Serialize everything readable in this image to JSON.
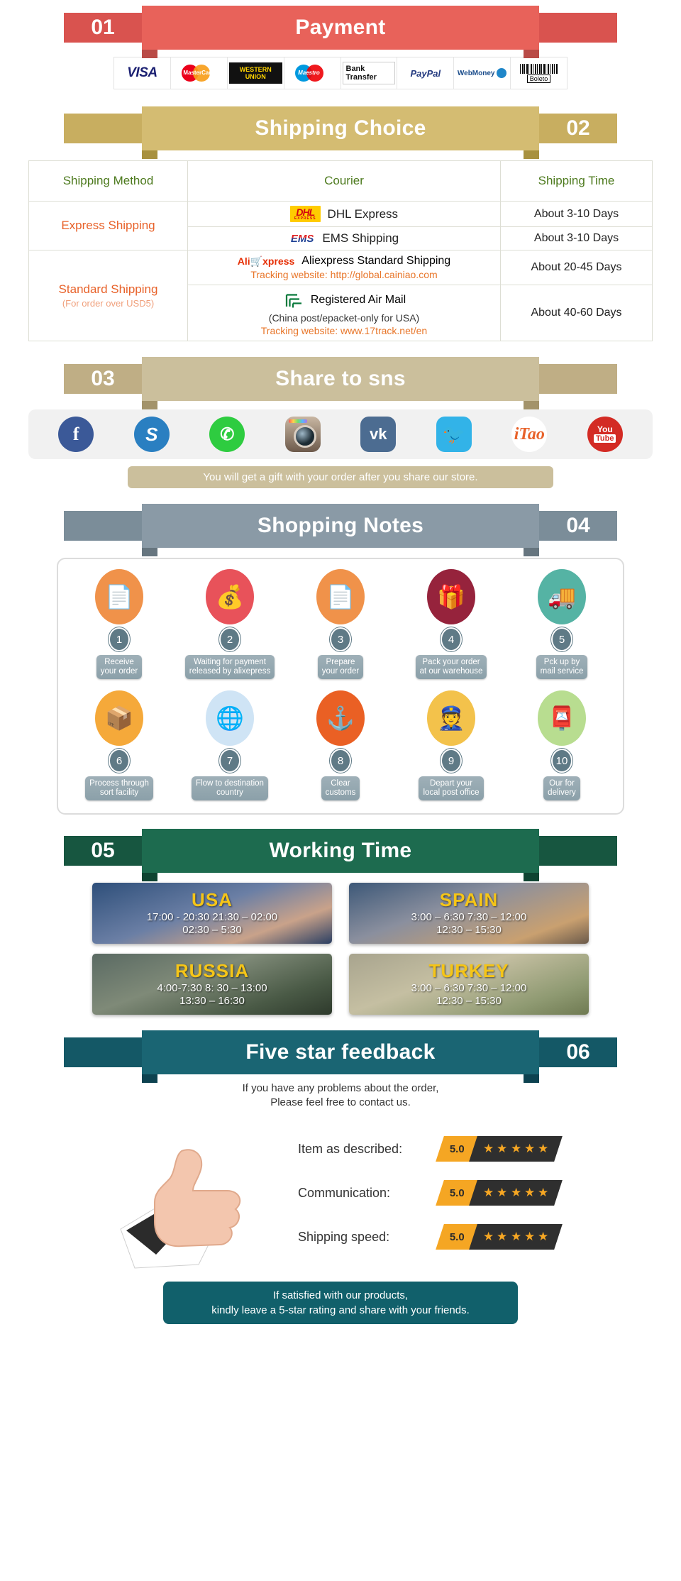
{
  "sections": {
    "payment": {
      "number": "01",
      "title": "Payment",
      "methods": [
        {
          "name": "visa-logo",
          "label": "VISA"
        },
        {
          "name": "mastercard-logo",
          "label": "MasterCard"
        },
        {
          "name": "western-union-logo",
          "label": "WESTERN UNION"
        },
        {
          "name": "maestro-logo",
          "label": "Maestro"
        },
        {
          "name": "bank-transfer-logo",
          "label": "Bank Transfer"
        },
        {
          "name": "paypal-logo",
          "label": "PayPal"
        },
        {
          "name": "webmoney-logo",
          "label": "WebMoney"
        },
        {
          "name": "boleto-logo",
          "label": "Boleto"
        }
      ]
    },
    "shipping": {
      "number": "02",
      "title": "Shipping Choice",
      "headers": [
        "Shipping Method",
        "Courier",
        "Shipping Time"
      ],
      "groups": [
        {
          "method": "Express Shipping",
          "method_sub": "",
          "rows": [
            {
              "courier": "DHL Express",
              "logo": "dhl-logo",
              "tracking": "",
              "sub": "",
              "time": "About 3-10 Days"
            },
            {
              "courier": "EMS Shipping",
              "logo": "ems-logo",
              "tracking": "",
              "sub": "",
              "time": "About 3-10 Days"
            }
          ]
        },
        {
          "method": "Standard Shipping",
          "method_sub": "(For order over USD5)",
          "rows": [
            {
              "courier": "Aliexpress Standard Shipping",
              "logo": "aliexpress-logo",
              "tracking": "Tracking website: http://global.cainiao.com",
              "sub": "",
              "time": "About 20-45 Days"
            },
            {
              "courier": "Registered Air Mail",
              "logo": "china-post-logo",
              "tracking": "Tracking website: www.17track.net/en",
              "sub": "(China post/epacket-only for USA)",
              "time": "About 40-60 Days"
            }
          ]
        }
      ]
    },
    "share": {
      "number": "03",
      "title": "Share to sns",
      "icons": [
        {
          "name": "facebook-icon",
          "label": "f"
        },
        {
          "name": "skype-icon",
          "label": "S"
        },
        {
          "name": "whatsapp-icon",
          "label": "✆"
        },
        {
          "name": "instagram-icon",
          "label": ""
        },
        {
          "name": "vk-icon",
          "label": "vk"
        },
        {
          "name": "twitter-icon",
          "label": "🐦"
        },
        {
          "name": "itao-icon",
          "label": "iTao"
        },
        {
          "name": "youtube-icon",
          "label": "You"
        }
      ],
      "youtube_top": "You",
      "youtube_bottom": "Tube",
      "gift_note": "You will get a gift with your order after you share our store."
    },
    "notes": {
      "number": "04",
      "title": "Shopping Notes",
      "steps": [
        {
          "num": "1",
          "label": "Receive\nyour order",
          "icon": "document-hand-icon",
          "color": "#f0924a",
          "glyph": "📄"
        },
        {
          "num": "2",
          "label": "Waiting for payment\nreleased by alixepress",
          "icon": "money-bag-icon",
          "color": "#e8525a",
          "glyph": "💰"
        },
        {
          "num": "3",
          "label": "Prepare\nyour order",
          "icon": "document-hand-icon",
          "color": "#f0924a",
          "glyph": "📄"
        },
        {
          "num": "4",
          "label": "Pack your order\nat our warehouse",
          "icon": "gift-box-icon",
          "color": "#96233c",
          "glyph": "🎁"
        },
        {
          "num": "5",
          "label": "Pck up by\nmail service",
          "icon": "mail-truck-icon",
          "color": "#55b3a4",
          "glyph": "🚚"
        },
        {
          "num": "6",
          "label": "Process through\nsort facility",
          "icon": "hand-truck-icon",
          "color": "#f5a93a",
          "glyph": "📦"
        },
        {
          "num": "7",
          "label": "Flow to destination\ncountry",
          "icon": "globe-icon",
          "color": "#cfe4f5",
          "glyph": "🌐"
        },
        {
          "num": "8",
          "label": "Clear\ncustoms",
          "icon": "anchor-icon",
          "color": "#ea6024",
          "glyph": "⚓"
        },
        {
          "num": "9",
          "label": "Depart your\nlocal post office",
          "icon": "postman-icon",
          "color": "#f3c24b",
          "glyph": "👮"
        },
        {
          "num": "10",
          "label": "Our for\ndelivery",
          "icon": "parcel-icon",
          "color": "#b8dd90",
          "glyph": "📮"
        }
      ]
    },
    "working_time": {
      "number": "05",
      "title": "Working Time",
      "cities": [
        {
          "name": "USA",
          "times": "17:00 - 20:30  21:30 – 02:00\n02:30 – 5:30",
          "theme": "wt-usa"
        },
        {
          "name": "SPAIN",
          "times": "3:00 – 6:30   7:30 – 12:00\n12:30 – 15:30",
          "theme": "wt-spain"
        },
        {
          "name": "RUSSIA",
          "times": "4:00-7:30   8: 30 – 13:00\n13:30 – 16:30",
          "theme": "wt-russia"
        },
        {
          "name": "TURKEY",
          "times": "3:00 – 6:30   7:30 – 12:00\n12:30 – 15:30",
          "theme": "wt-turkey"
        }
      ]
    },
    "feedback": {
      "number": "06",
      "title": "Five star feedback",
      "subtitle": "If you have any problems about the order,\nPlease feel free to contact us.",
      "ratings": [
        {
          "label": "Item as described:",
          "score": "5.0",
          "stars": 5
        },
        {
          "label": "Communication:",
          "score": "5.0",
          "stars": 5
        },
        {
          "label": "Shipping speed:",
          "score": "5.0",
          "stars": 5
        }
      ],
      "closing": "If satisfied with our products,\nkindly leave a 5-star rating and share with your friends."
    }
  },
  "colors": {
    "payment_red": "#e8625a",
    "shipping_gold": "#d4bc72",
    "share_tan": "#cbbf9c",
    "notes_slate": "#8a9aa6",
    "working_green": "#1d6b4f",
    "feedback_teal": "#1a6573",
    "star_gold": "#f5a623"
  }
}
